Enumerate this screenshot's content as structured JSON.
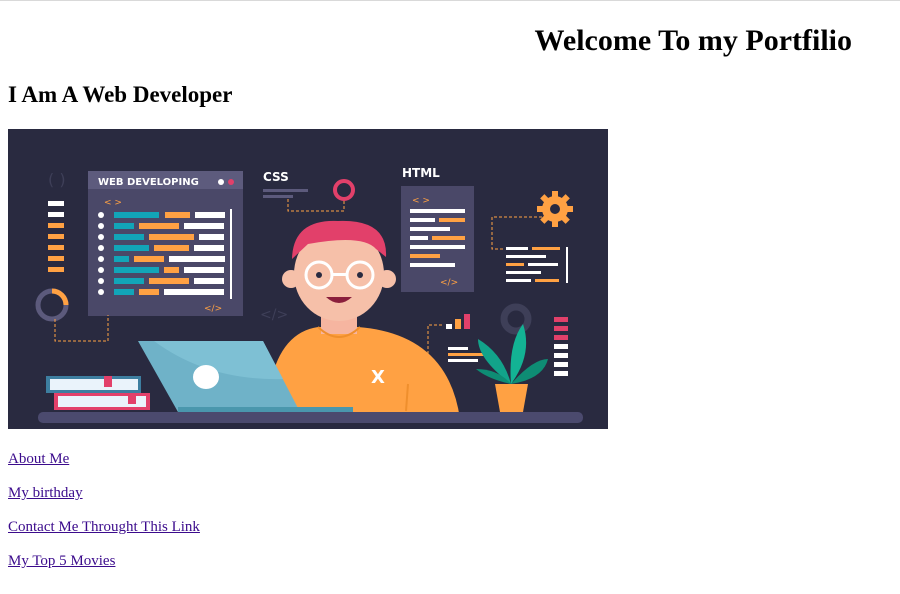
{
  "page": {
    "title": "Welcome To my Portfilio",
    "subtitle": "I Am A Web Developer"
  },
  "hero": {
    "window_title": "WEB DEVELOPING",
    "css_label": "CSS",
    "html_label": "HTML",
    "code_tag": "< >",
    "close_tag": "</>",
    "shirt_mark": "X",
    "colors": {
      "background": "#292a40",
      "panel": "#4a4868",
      "orange": "#ffa143",
      "teal": "#12a5b8",
      "pink": "#e2406a",
      "laptop": "#6fb2c8"
    }
  },
  "links": [
    {
      "label": "About Me"
    },
    {
      "label": "My birthday"
    },
    {
      "label": "Contact Me Throught This Link"
    },
    {
      "label": "My Top 5 Movies"
    }
  ]
}
